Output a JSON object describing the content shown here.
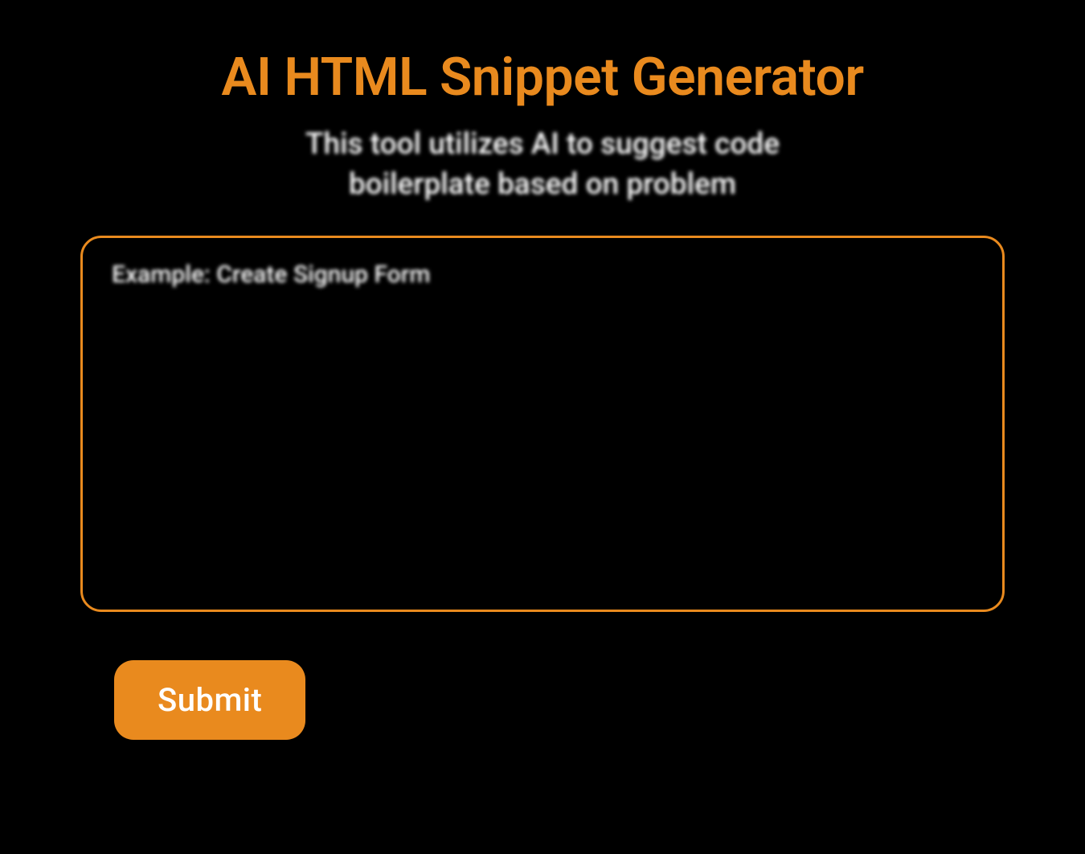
{
  "header": {
    "title": "AI HTML Snippet Generator",
    "subtitle_line1": "This tool utilizes AI to suggest code",
    "subtitle_line2": "boilerplate based on problem"
  },
  "form": {
    "prompt_placeholder": "Example: Create Signup Form",
    "prompt_value": "",
    "submit_label": "Submit"
  },
  "colors": {
    "accent": "#e98a1e",
    "background": "#000000",
    "text_light": "#ffffff"
  }
}
